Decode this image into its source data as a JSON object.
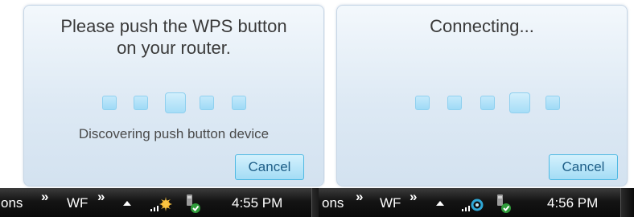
{
  "left": {
    "title_line1": "Please push the WPS button",
    "title_line2": "on your router.",
    "status": "Discovering push button device",
    "cancel_label": "Cancel",
    "taskbar": {
      "toolbar_label_cut": "ons",
      "chevron1": "»",
      "wf_label": "WF",
      "chevron2": "»",
      "clock": "4:55 PM"
    }
  },
  "right": {
    "title": "Connecting...",
    "cancel_label": "Cancel",
    "taskbar": {
      "toolbar_label_cut": "ons",
      "chevron1": "»",
      "wf_label": "WF",
      "chevron2": "»",
      "clock": "4:56 PM"
    }
  },
  "icons": {
    "overflow": "tray-overflow-arrow-icon",
    "network_searching": "network-searching-icon",
    "network_connecting": "network-connecting-icon",
    "usb_safe_remove": "usb-safe-remove-icon"
  },
  "colors": {
    "flyout_bg": "#dde9f4",
    "progress_dot": "#9fdaf6",
    "button_border": "#4fb9e3",
    "taskbar": "#141414"
  }
}
